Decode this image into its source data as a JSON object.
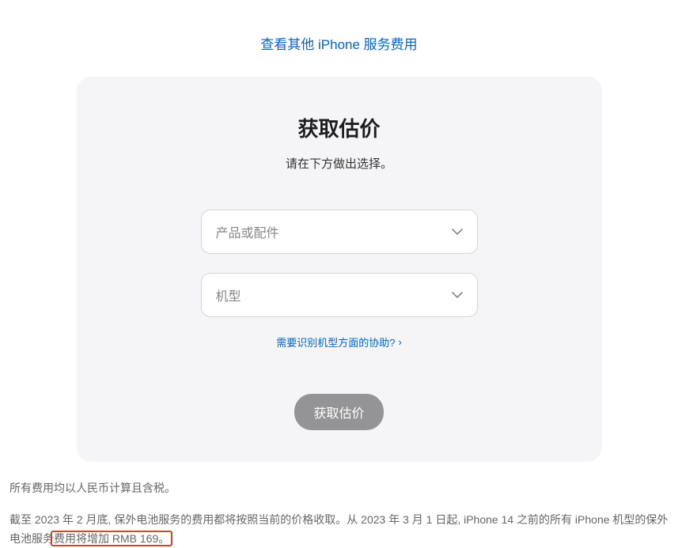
{
  "top_link": "查看其他 iPhone 服务费用",
  "card": {
    "title": "获取估价",
    "subtitle": "请在下方做出选择。",
    "select_product_placeholder": "产品或配件",
    "select_model_placeholder": "机型",
    "help_link": "需要识别机型方面的协助?",
    "button_label": "获取估价"
  },
  "footnotes": {
    "line1": "所有费用均以人民币计算且含税。",
    "line2_part1": "截至 2023 年 2 月底, 保外电池服务的费用都将按照当前的价格收取。从 2023 年 3 月 1 日起, iPhone 14 之前的所有 iPhone 机型的保外电池服务",
    "line2_part2": "费用将增加 RMB 169。"
  }
}
